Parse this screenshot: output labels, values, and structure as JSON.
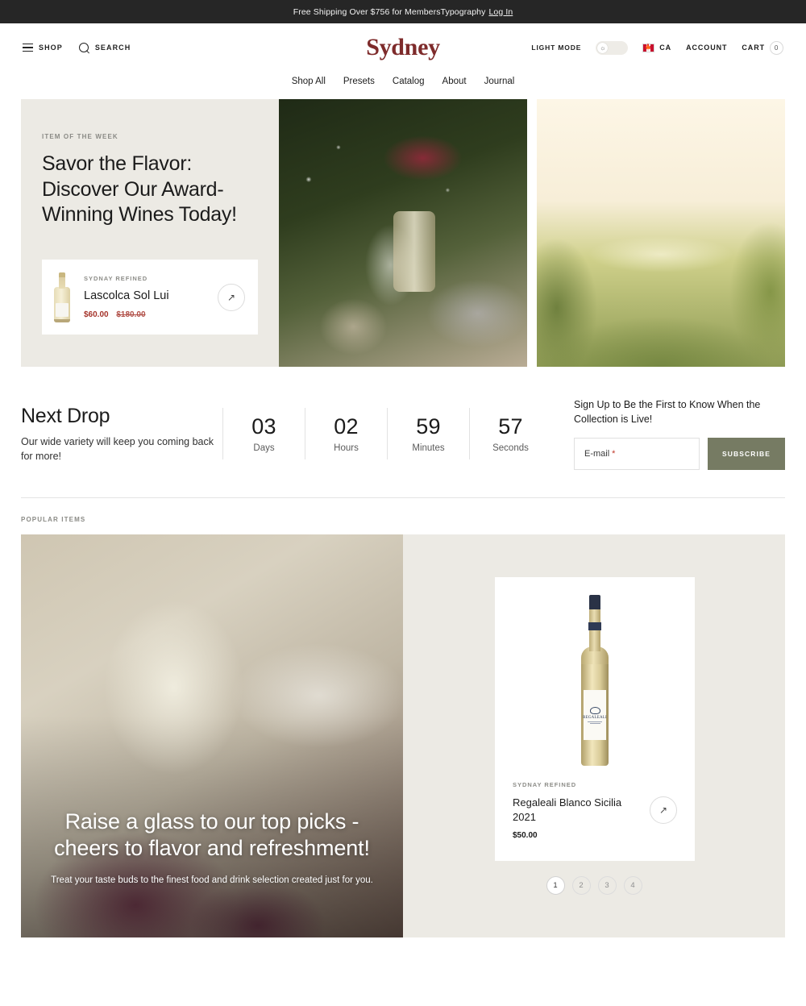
{
  "announcement": {
    "text": "Free Shipping Over $756 for MembersTypography",
    "link_label": "Log In"
  },
  "header": {
    "shop_label": "SHOP",
    "search_label": "SEARCH",
    "logo": "Sydney",
    "light_mode_label": "LIGHT MODE",
    "country_label": "CA",
    "account_label": "ACCOUNT",
    "cart_label": "CART",
    "cart_count": "0"
  },
  "nav": {
    "items": [
      {
        "label": "Shop All"
      },
      {
        "label": "Presets"
      },
      {
        "label": "Catalog"
      },
      {
        "label": "About"
      },
      {
        "label": "Journal"
      }
    ]
  },
  "hero": {
    "eyebrow": "ITEM OF THE WEEK",
    "title": "Savor the Flavor: Discover Our Award-Winning Wines Today!",
    "product": {
      "brand": "SYDNAY REFINED",
      "name": "Lascolca Sol Lui",
      "sale_price": "$60.00",
      "original_price": "$180.00",
      "cta_icon": "↗"
    }
  },
  "next_drop": {
    "title": "Next Drop",
    "description": "Our wide variety will keep you coming back for more!",
    "counters": [
      {
        "value": "03",
        "label": "Days"
      },
      {
        "value": "02",
        "label": "Hours"
      },
      {
        "value": "59",
        "label": "Minutes"
      },
      {
        "value": "57",
        "label": "Seconds"
      }
    ],
    "signup_heading": "Sign Up to Be the First to Know When the Collection is Live!",
    "email_label": "E-mail",
    "email_required_mark": "*",
    "email_value": "",
    "subscribe_label": "SUBSCRIBE"
  },
  "popular": {
    "section_label": "POPULAR ITEMS",
    "promo_title": "Raise a glass to our top picks - cheers to flavor and refreshment!",
    "promo_subtitle": "Treat your taste buds to the finest food and drink selection created just for you.",
    "product": {
      "brand": "SYDNAY REFINED",
      "name": "Regaleali Blanco Sicilia 2021",
      "price": "$50.00",
      "label_text": "REGALEALI",
      "cta_icon": "↗"
    },
    "pagination": [
      {
        "label": "1"
      },
      {
        "label": "2"
      },
      {
        "label": "3"
      },
      {
        "label": "4"
      }
    ]
  },
  "colors": {
    "accent": "#7e2b2b",
    "sale": "#a5342b",
    "subscribe": "#767b63",
    "panel": "#eceae4",
    "announce_bg": "#262626"
  }
}
